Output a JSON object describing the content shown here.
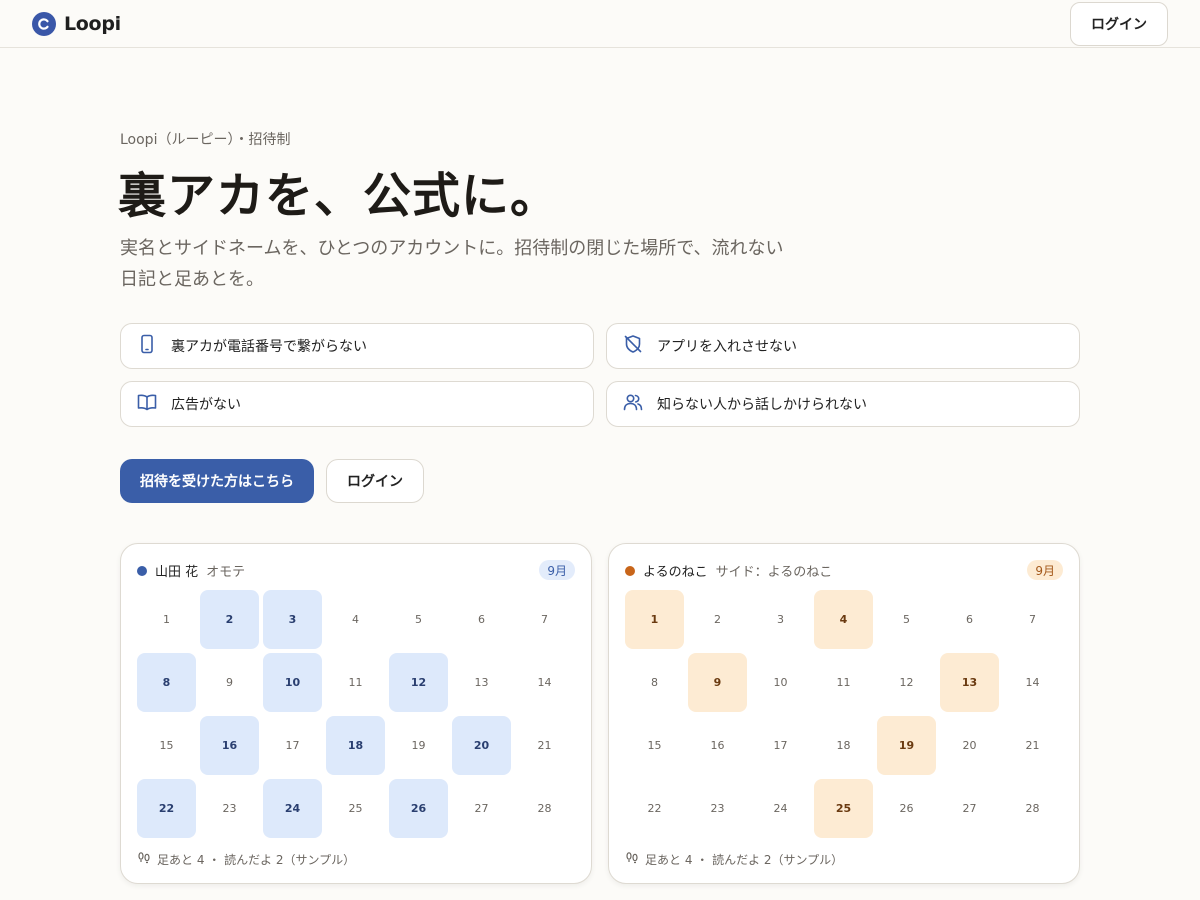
{
  "header": {
    "logo_text": "Loopi",
    "login_label": "ログイン"
  },
  "hero": {
    "eyebrow": "Loopi（ルーピー）・招待制",
    "title": "裏アカを、公式に。",
    "subtitle_line1": "実名とサイドネームを、ひとつのアカウントに。招待制の閉じた場所で、流れない",
    "subtitle_line2": "日記と足あとを。"
  },
  "features": [
    {
      "label": "裏アカが電話番号で繋がらない",
      "icon": "smartphone-icon"
    },
    {
      "label": "アプリを入れさせない",
      "icon": "shield-off-icon"
    },
    {
      "label": "広告がない",
      "icon": "book-open-icon"
    },
    {
      "label": "知らない人から話しかけられない",
      "icon": "users-icon"
    }
  ],
  "cta": {
    "primary_label": "招待を受けた方はこちら",
    "secondary_label": "ログイン"
  },
  "cards": [
    {
      "name": "山田 花",
      "role": "オモテ",
      "month": "9月",
      "dot_color": "#3a5ea8",
      "badge_bg": "#e3ecfb",
      "badge_fg": "#3a5ea8",
      "active_bg": "#dde9fb",
      "active_fg": "#2a3f70",
      "days": [
        1,
        2,
        3,
        4,
        5,
        6,
        7,
        8,
        9,
        10,
        11,
        12,
        13,
        14,
        15,
        16,
        17,
        18,
        19,
        20,
        21,
        22,
        23,
        24,
        25,
        26,
        27,
        28
      ],
      "active_days": [
        2,
        3,
        8,
        10,
        12,
        16,
        18,
        20,
        22,
        24,
        26
      ],
      "footer": "足あと 4 ・ 読んだよ 2（サンプル）"
    },
    {
      "name": "よるのねこ",
      "role": "サイド：よるのねこ",
      "month": "9月",
      "dot_color": "#c8651a",
      "badge_bg": "#fdebd3",
      "badge_fg": "#a4581a",
      "active_bg": "#fdebd3",
      "active_fg": "#6a3a10",
      "days": [
        1,
        2,
        3,
        4,
        5,
        6,
        7,
        8,
        9,
        10,
        11,
        12,
        13,
        14,
        15,
        16,
        17,
        18,
        19,
        20,
        21,
        22,
        23,
        24,
        25,
        26,
        27,
        28
      ],
      "active_days": [
        1,
        4,
        9,
        13,
        19,
        25
      ],
      "footer": "足あと 4 ・ 読んだよ 2（サンプル）"
    }
  ]
}
